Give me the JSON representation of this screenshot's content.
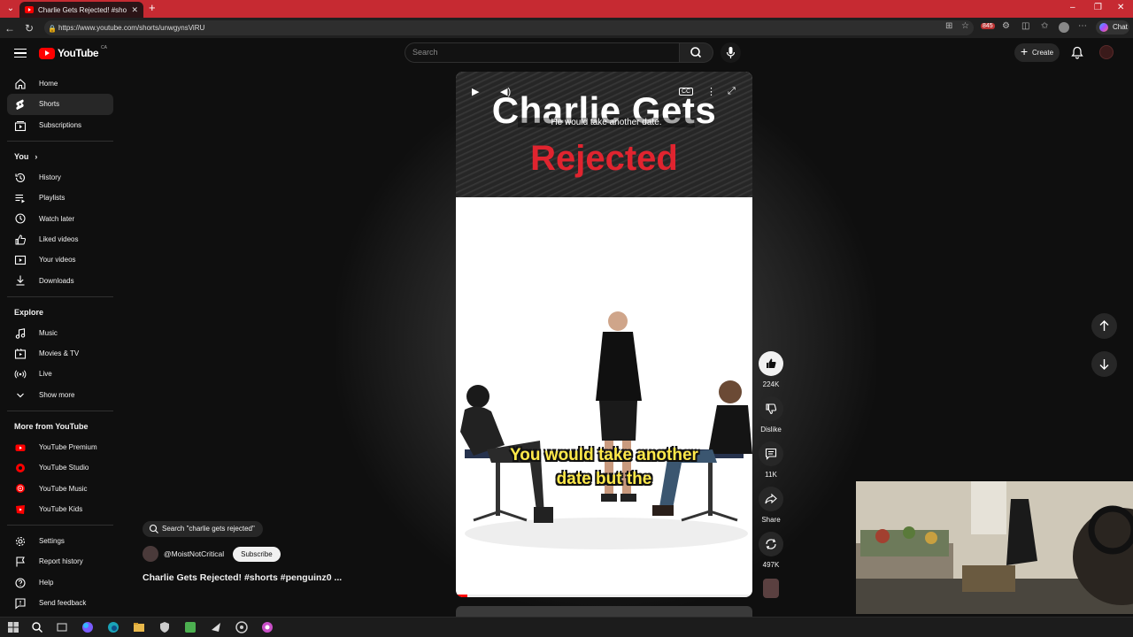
{
  "browser": {
    "tab_title": "Charlie Gets Rejected! #shorts #p",
    "url": "https://www.youtube.com/shorts/unwgynsViRU",
    "badge_count": "845",
    "chat_label": "Chat"
  },
  "header": {
    "logo_text": "YouTube",
    "country": "CA",
    "search_placeholder": "Search",
    "create_label": "Create"
  },
  "sidebar": {
    "main": [
      {
        "label": "Home",
        "icon": "home-icon"
      },
      {
        "label": "Shorts",
        "icon": "shorts-icon"
      },
      {
        "label": "Subscriptions",
        "icon": "subscriptions-icon"
      }
    ],
    "you_heading": "You",
    "you": [
      {
        "label": "History",
        "icon": "history-icon"
      },
      {
        "label": "Playlists",
        "icon": "playlists-icon"
      },
      {
        "label": "Watch later",
        "icon": "watch-later-icon"
      },
      {
        "label": "Liked videos",
        "icon": "liked-icon"
      },
      {
        "label": "Your videos",
        "icon": "your-videos-icon"
      },
      {
        "label": "Downloads",
        "icon": "downloads-icon"
      }
    ],
    "explore_heading": "Explore",
    "explore": [
      {
        "label": "Music",
        "icon": "music-icon"
      },
      {
        "label": "Movies & TV",
        "icon": "movies-icon"
      },
      {
        "label": "Live",
        "icon": "live-icon"
      },
      {
        "label": "Show more",
        "icon": "chevron-down-icon"
      }
    ],
    "more_heading": "More from YouTube",
    "more": [
      {
        "label": "YouTube Premium"
      },
      {
        "label": "YouTube Studio"
      },
      {
        "label": "YouTube Music"
      },
      {
        "label": "YouTube Kids"
      }
    ],
    "settings": [
      {
        "label": "Settings",
        "icon": "gear-icon"
      },
      {
        "label": "Report history",
        "icon": "flag-icon"
      },
      {
        "label": "Help",
        "icon": "help-icon"
      },
      {
        "label": "Send feedback",
        "icon": "feedback-icon"
      }
    ]
  },
  "video": {
    "title_line1": "Charlie Gets",
    "title_line2": "Rejected",
    "caption_top": "He would take another date.",
    "subtitle_line1": "You would take another",
    "subtitle_line2": "date but the",
    "progress": 0.04
  },
  "actions": {
    "likes": "224K",
    "dislike_label": "Dislike",
    "comments": "11K",
    "share_label": "Share",
    "remix": "497K"
  },
  "info": {
    "search_chip": "Search \"charlie gets rejected\"",
    "channel": "@MoistNotCritical",
    "subscribe_label": "Subscribe",
    "video_title": "Charlie Gets Rejected! #shorts #penguinz0 ..."
  },
  "colors": {
    "tabbar": "#c62a32",
    "background": "#0f0f0f",
    "accent_red": "#ff0000",
    "title_red": "#e0242f",
    "subtitle_yellow": "#ffe94a"
  }
}
